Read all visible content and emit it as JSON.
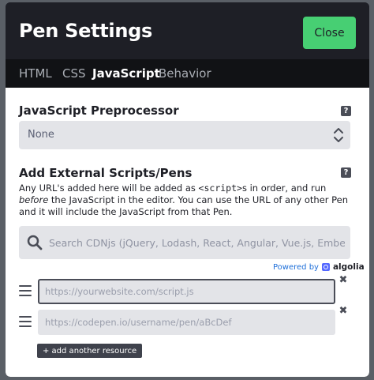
{
  "modal": {
    "title": "Pen Settings",
    "close_label": "Close"
  },
  "tabs": [
    {
      "label": "HTML",
      "active": false
    },
    {
      "label": "CSS",
      "active": false
    },
    {
      "label": "JavaScript",
      "active": true
    },
    {
      "label": "Behavior",
      "active": false
    }
  ],
  "preprocessor": {
    "title": "JavaScript Preprocessor",
    "help": "?",
    "selected": "None"
  },
  "external": {
    "title": "Add External Scripts/Pens",
    "help": "?",
    "desc_part1": "Any URL's added here will be added as ",
    "desc_code": "<script>",
    "desc_part2": "s in order, and run ",
    "desc_em": "before",
    "desc_part3": " the JavaScript in the editor. You can use the URL of any other Pen and it will include the JavaScript from that Pen.",
    "search_placeholder": "Search CDNjs (jQuery, Lodash, React, Angular, Vue.js, Ember...)",
    "powered_by": "Powered by",
    "algolia": "algolia",
    "resources": [
      {
        "placeholder": "https://yourwebsite.com/script.js",
        "value": "",
        "focused": true
      },
      {
        "placeholder": "https://codepen.io/username/pen/aBcDef",
        "value": "",
        "focused": false
      }
    ],
    "remove_symbol": "✖",
    "add_label": "+ add another resource"
  },
  "colors": {
    "header_bg": "#1e1f26",
    "tab_bar_bg": "#111215",
    "close_button": "#47cf73",
    "input_bg": "#e3e4e8",
    "link_blue": "#1e6fd9"
  }
}
